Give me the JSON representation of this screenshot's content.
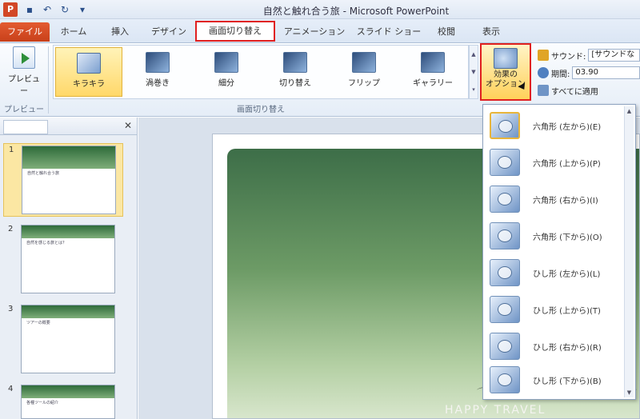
{
  "window": {
    "app_icon": "P",
    "title": "自然と触れ合う旅 - Microsoft PowerPoint"
  },
  "tabs": [
    {
      "label": "ファイル"
    },
    {
      "label": "ホーム"
    },
    {
      "label": "挿入"
    },
    {
      "label": "デザイン"
    },
    {
      "label": "画面切り替え"
    },
    {
      "label": "アニメーション"
    },
    {
      "label": "スライド ショー"
    },
    {
      "label": "校閲"
    },
    {
      "label": "表示"
    }
  ],
  "ribbon": {
    "preview_button": "プレビュー",
    "preview_group": "プレビュー",
    "transitions_group": "画面切り替え",
    "gallery": [
      {
        "label": "キラキラ"
      },
      {
        "label": "渦巻き"
      },
      {
        "label": "細分"
      },
      {
        "label": "切り替え"
      },
      {
        "label": "フリップ"
      },
      {
        "label": "ギャラリー"
      }
    ],
    "effect_options_line1": "効果の",
    "effect_options_line2": "オプション",
    "timing": {
      "sound_label": "サウンド:",
      "sound_value": "[サウンドな",
      "duration_label": "期間:",
      "duration_value": "03.90",
      "apply_all": "すべてに適用"
    }
  },
  "slides": [
    {
      "number": "1",
      "text": "自然と触れ合う旅"
    },
    {
      "number": "2",
      "text": "自然を感じる旅とは？"
    },
    {
      "number": "3",
      "text": "ツアーの概要"
    },
    {
      "number": "4",
      "text": "各種ツールの紹介"
    }
  ],
  "main_slide": {
    "caption": "HAPPY TRAVEL"
  },
  "dropdown": {
    "items": [
      {
        "label": "六角形 (左から)(E)"
      },
      {
        "label": "六角形 (上から)(P)"
      },
      {
        "label": "六角形 (右から)(I)"
      },
      {
        "label": "六角形 (下から)(O)"
      },
      {
        "label": "ひし形 (左から)(L)"
      },
      {
        "label": "ひし形 (上から)(T)"
      },
      {
        "label": "ひし形 (右から)(R)"
      },
      {
        "label": "ひし形 (下から)(B)"
      }
    ]
  }
}
